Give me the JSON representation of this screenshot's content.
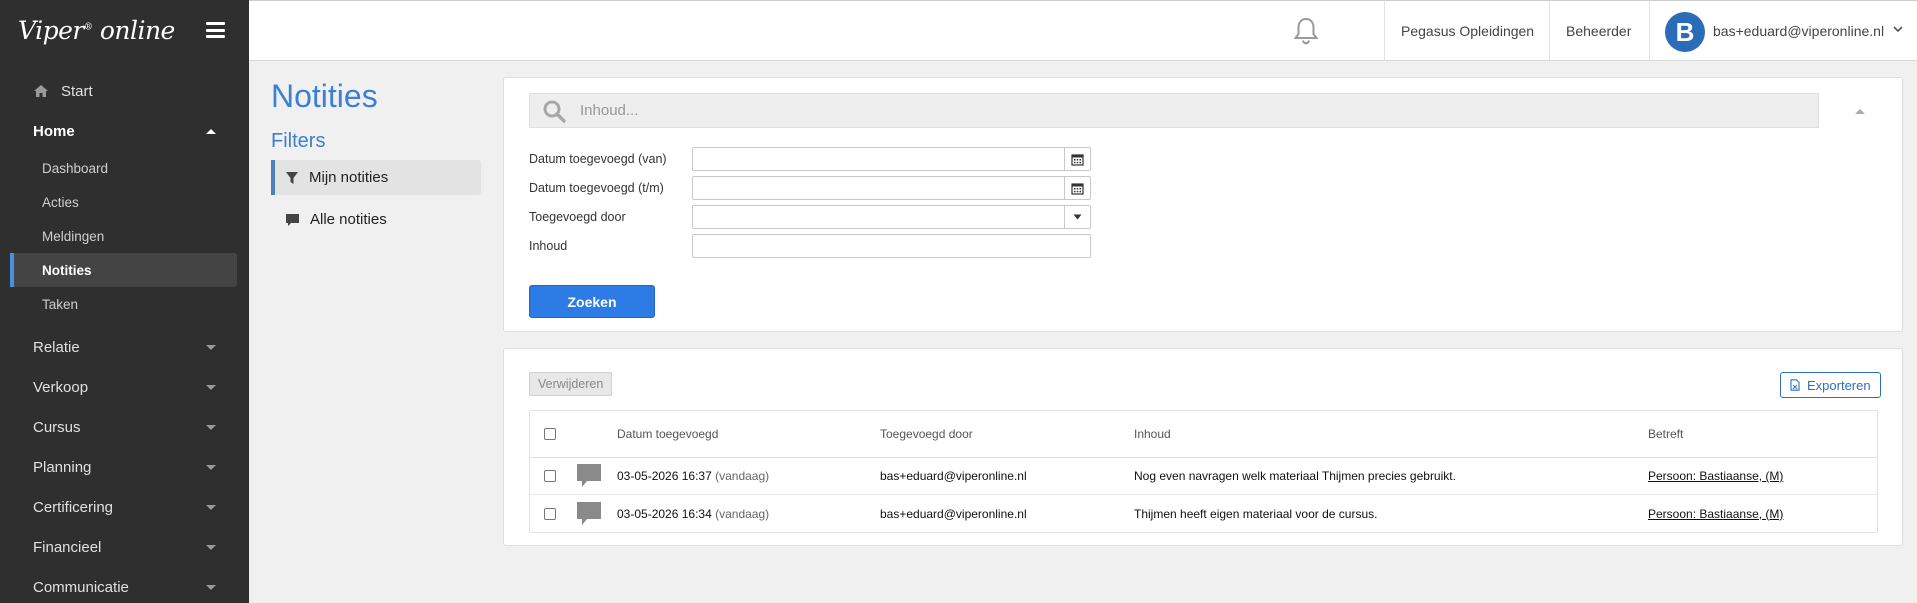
{
  "app": {
    "logo_main": "Viper",
    "logo_sup": "®",
    "logo_suffix": "online"
  },
  "sidebar": {
    "start": "Start",
    "home": "Home",
    "home_items": [
      "Dashboard",
      "Acties",
      "Meldingen",
      "Notities",
      "Taken"
    ],
    "active_sub_item": "Notities",
    "sections": [
      "Relatie",
      "Verkoop",
      "Cursus",
      "Planning",
      "Certificering",
      "Financieel",
      "Communicatie"
    ]
  },
  "topbar": {
    "organization": "Pegasus Opleidingen",
    "role": "Beheerder",
    "avatar_letter": "B",
    "user_email": "bas+eduard@viperonline.nl"
  },
  "page": {
    "title": "Notities",
    "filters_title": "Filters",
    "filters": [
      {
        "label": "Mijn notities",
        "active": true
      },
      {
        "label": "Alle notities",
        "active": false
      }
    ]
  },
  "search": {
    "placeholder": "Inhoud...",
    "fields": {
      "date_from_label": "Datum toegevoegd (van)",
      "date_to_label": "Datum toegevoegd (t/m)",
      "added_by_label": "Toegevoegd door",
      "content_label": "Inhoud"
    },
    "submit_label": "Zoeken"
  },
  "results": {
    "delete_label": "Verwijderen",
    "export_label": "Exporteren",
    "columns": {
      "date": "Datum toegevoegd",
      "added_by": "Toegevoegd door",
      "content": "Inhoud",
      "concerns": "Betreft"
    },
    "rows": [
      {
        "date": "03-05-2026 16:37",
        "relative": "(vandaag)",
        "added_by": "bas+eduard@viperonline.nl",
        "content": "Nog even navragen welk materiaal Thijmen precies gebruikt.",
        "concerns": "Persoon: Bastiaanse, (M)"
      },
      {
        "date": "03-05-2026 16:34",
        "relative": "(vandaag)",
        "added_by": "bas+eduard@viperonline.nl",
        "content": "Thijmen heeft eigen materiaal voor de cursus.",
        "concerns": "Persoon: Bastiaanse, (M)"
      }
    ]
  },
  "colors": {
    "sidebar_bg": "#2f2f2f",
    "accent": "#3d7fd4",
    "primary_button": "#2d7ce6",
    "avatar": "#2b6cb8"
  }
}
